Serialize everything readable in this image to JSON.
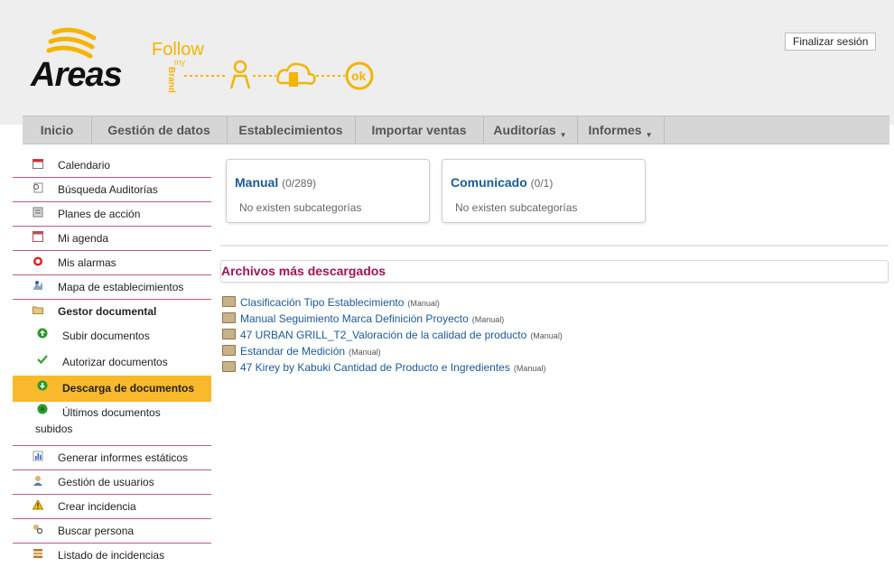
{
  "header": {
    "logout_label": "Finalizar sesión",
    "logo_text": "Areas",
    "brand_follow": "Follow",
    "brand_my": "my",
    "brand_brand": "Brand",
    "brand_ok": "ok"
  },
  "nav": {
    "items": [
      {
        "label": "Inicio"
      },
      {
        "label": "Gestión de datos"
      },
      {
        "label": "Establecimientos"
      },
      {
        "label": "Importar ventas"
      },
      {
        "label": "Auditorías"
      },
      {
        "label": "Informes"
      }
    ],
    "caret": "▼"
  },
  "sidebar": {
    "items": [
      {
        "label": "Calendario",
        "icon": "calendar-icon"
      },
      {
        "label": "Búsqueda Auditorías",
        "icon": "search-doc-icon"
      },
      {
        "label": "Planes de acción",
        "icon": "plan-icon"
      },
      {
        "label": "Mi agenda",
        "icon": "agenda-icon"
      },
      {
        "label": "Mis alarmas",
        "icon": "alarm-icon"
      },
      {
        "label": "Mapa de establecimientos",
        "icon": "map-icon"
      },
      {
        "label": "Gestor documental",
        "icon": "folder-icon"
      }
    ],
    "sub_items": [
      {
        "label": "Subir documentos",
        "icon": "upload-icon"
      },
      {
        "label": "Autorizar documentos",
        "icon": "check-icon"
      },
      {
        "label": "Descarga de documentos",
        "icon": "download-icon"
      },
      {
        "label": "Últimos documentos subidos",
        "icon": "recent-icon"
      }
    ],
    "items_after": [
      {
        "label": "Generar informes estáticos",
        "icon": "report-icon"
      },
      {
        "label": "Gestión de usuarios",
        "icon": "users-icon"
      },
      {
        "label": "Crear incidencia",
        "icon": "warning-icon"
      },
      {
        "label": "Buscar persona",
        "icon": "person-search-icon"
      },
      {
        "label": "Listado de incidencias",
        "icon": "list-icon"
      }
    ]
  },
  "categories": [
    {
      "title": "Manual",
      "count": "(0/289)",
      "empty": "No existen subcategorías"
    },
    {
      "title": "Comunicado",
      "count": "(0/1)",
      "empty": "No existen subcategorías"
    }
  ],
  "downloads": {
    "title": "Archivos más descargados",
    "items": [
      {
        "name": "Clasificación Tipo Establecimiento",
        "tag": "(Manual)"
      },
      {
        "name": "Manual Seguimiento Marca Definición Proyecto",
        "tag": "(Manual)"
      },
      {
        "name": "47 URBAN GRILL_T2_Valoración de la calidad de producto",
        "tag": "(Manual)"
      },
      {
        "name": "Estandar de Medición",
        "tag": "(Manual)"
      },
      {
        "name": "47 Kirey by Kabuki Cantidad de Producto e Ingredientes",
        "tag": "(Manual)"
      }
    ]
  },
  "colors": {
    "accent": "#f9b92c",
    "brand_yellow": "#f4b400",
    "link": "#1a5a96",
    "section_title": "#a11452",
    "sidebar_divider": "#c0588a"
  }
}
